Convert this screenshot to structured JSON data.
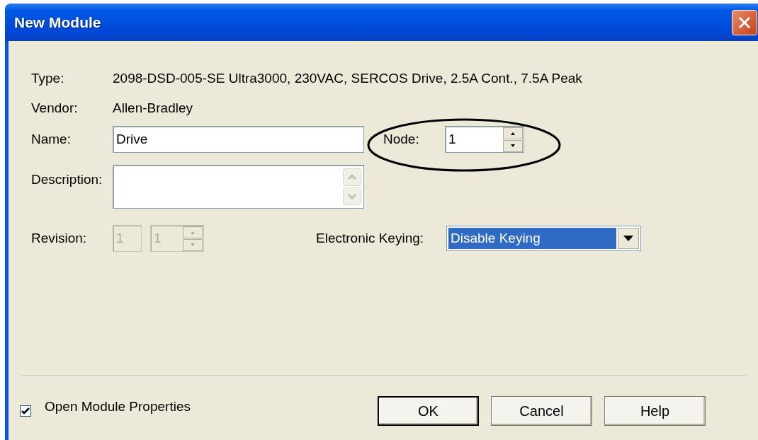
{
  "window": {
    "title": "New Module"
  },
  "info": [
    {
      "label": "Type:",
      "value": "2098-DSD-005-SE Ultra3000, 230VAC, SERCOS Drive, 2.5A Cont., 7.5A Peak"
    },
    {
      "label": "Vendor:",
      "value": "Allen-Bradley"
    }
  ],
  "name": {
    "label": "Name:",
    "value": "Drive"
  },
  "node": {
    "label": "Node:",
    "value": "1"
  },
  "description": {
    "label": "Description:"
  },
  "revision": {
    "label": "Revision:",
    "major": "1",
    "minor": "1",
    "disabled": true
  },
  "electronic_keying": {
    "label": "Electronic Keying:",
    "value": "Disable Keying",
    "highlighted": true
  },
  "open_module_properties": {
    "label": "Open Module Properties",
    "checked": true
  },
  "buttons": [
    {
      "label": "OK",
      "default": true
    },
    {
      "label": "Cancel",
      "default": false
    },
    {
      "label": "Help",
      "default": false
    }
  ]
}
